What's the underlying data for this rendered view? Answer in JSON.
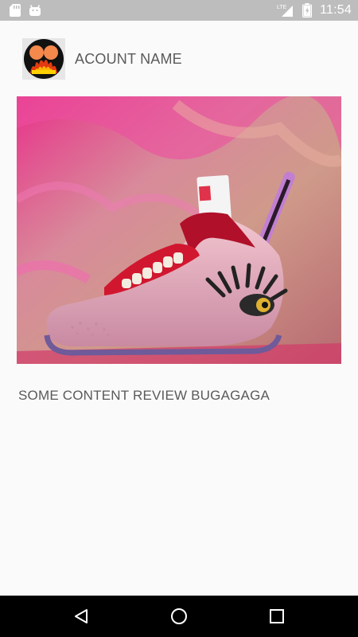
{
  "status_bar": {
    "time": "11:54",
    "network": "LTE",
    "icons": [
      "sd-card-icon",
      "android-icon",
      "signal-icon",
      "battery-icon"
    ]
  },
  "account": {
    "name": "ACOUNT NAME",
    "avatar_icon": "avatar-fire-logo"
  },
  "post": {
    "image_icon": "post-image",
    "content": "SOME CONTENT REVIEW BUGAGAGA"
  },
  "nav": {
    "items": [
      "back-icon",
      "home-icon",
      "recents-icon"
    ]
  },
  "colors": {
    "status_bar": "#bdbdbd",
    "background": "#fafafa",
    "text": "#5a5a5a",
    "nav_bar": "#000000"
  }
}
